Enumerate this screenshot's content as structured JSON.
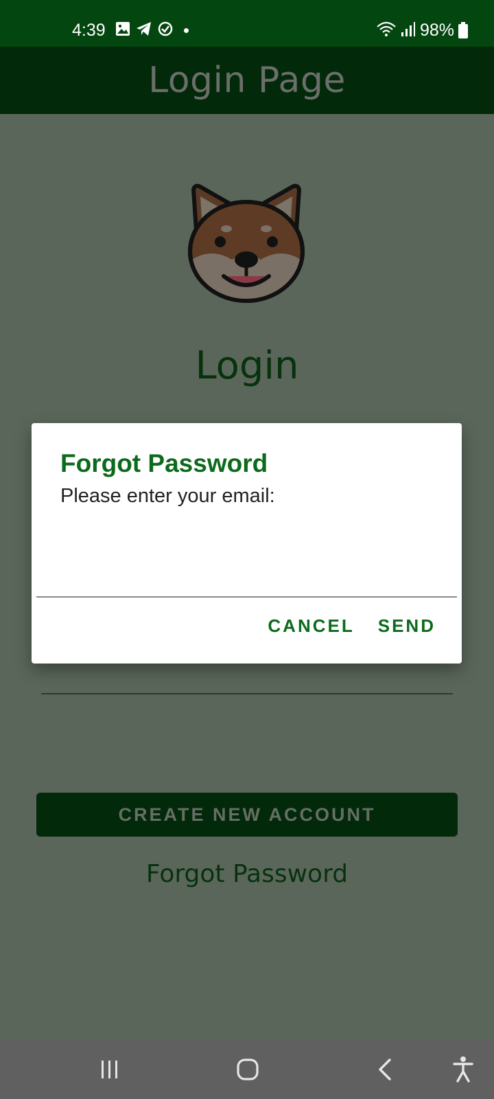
{
  "status_bar": {
    "time": "4:39",
    "battery": "98%",
    "icons": [
      "image-icon",
      "telegram-icon",
      "check-circle-icon",
      "notification-dot-icon",
      "wifi-icon",
      "signal-icon",
      "battery-icon"
    ]
  },
  "app_bar": {
    "title": "Login Page"
  },
  "main": {
    "logo": "shiba-dog-icon",
    "heading": "Login",
    "create_account_label": "CREATE NEW ACCOUNT",
    "forgot_password_link": "Forgot Password"
  },
  "dialog": {
    "title": "Forgot Password",
    "message": "Please enter your email:",
    "email_value": "",
    "cancel_label": "CANCEL",
    "send_label": "SEND"
  },
  "nav_bar": {
    "items": [
      "recent-apps-icon",
      "home-icon",
      "back-icon",
      "accessibility-icon"
    ]
  },
  "colors": {
    "status_bar": "#04460f",
    "app_bar": "#02290a",
    "scrim_background": "#5b665a",
    "accent_green": "#0c6a1c",
    "nav_bar": "#606060"
  }
}
